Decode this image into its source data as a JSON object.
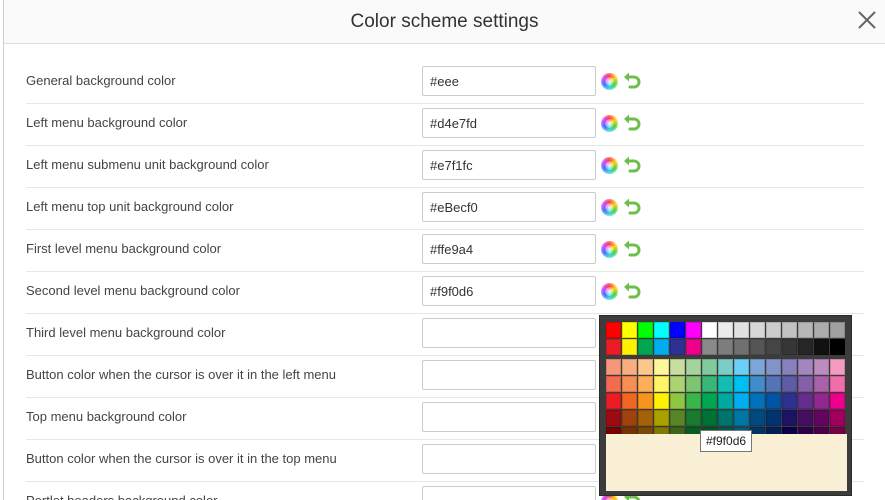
{
  "dialog": {
    "title": "Color scheme settings",
    "close_icon": "close-icon"
  },
  "settings": [
    {
      "label": "General background color",
      "value": "#eee"
    },
    {
      "label": "Left menu background color",
      "value": "#d4e7fd"
    },
    {
      "label": "Left menu submenu unit background color",
      "value": "#e7f1fc"
    },
    {
      "label": "Left menu top unit background color",
      "value": "#eBecf0"
    },
    {
      "label": "First level menu background color",
      "value": "#ffe9a4"
    },
    {
      "label": "Second level menu background color",
      "value": "#f9f0d6"
    },
    {
      "label": "Third level menu background color",
      "value": ""
    },
    {
      "label": "Button color when the cursor is over it in the left menu",
      "value": ""
    },
    {
      "label": "Top menu background color",
      "value": ""
    },
    {
      "label": "Button color when the cursor is over it in the top menu",
      "value": ""
    },
    {
      "label": "Portlet headers background color",
      "value": ""
    }
  ],
  "icons": {
    "color_wheel": "color-wheel-icon",
    "reset": "undo-arrow-icon"
  },
  "colors": {
    "reset_icon": "#6cbf4a",
    "picker_background": "#3c3c3c"
  },
  "picker": {
    "selected_value": "#f9f0d6",
    "palette_rows": [
      [
        "#ff0000",
        "#ffff00",
        "#00ff00",
        "#00ffff",
        "#0000ff",
        "#ff00ff",
        "#ffffff",
        "#ebebeb",
        "#e1e1e1",
        "#d7d7d7",
        "#cccccc",
        "#c2c2c2",
        "#b7b7b7",
        "#acacac",
        "#a0a0a0"
      ],
      [
        "#ed1c24",
        "#fff200",
        "#00a650",
        "#00aeef",
        "#2e3192",
        "#ec008c",
        "#898989",
        "#7d7d7d",
        "#707070",
        "#555555",
        "#464646",
        "#363636",
        "#262626",
        "#111111",
        "#000000"
      ],
      [
        "#f7977a",
        "#fbad82",
        "#fdc68c",
        "#fff799",
        "#c6df9c",
        "#a4d49d",
        "#81ca9d",
        "#7bcdc9",
        "#6ccff7",
        "#7ca6d8",
        "#8293ca",
        "#8881be",
        "#a286bd",
        "#bc8cbf",
        "#f49bc1"
      ],
      [
        "#f26c4f",
        "#f68e55",
        "#fbaf5a",
        "#fff467",
        "#acd372",
        "#7dc473",
        "#39b778",
        "#16bcb4",
        "#00bff3",
        "#438ccb",
        "#5573b7",
        "#5e5ca7",
        "#855fa8",
        "#a763a9",
        "#ef6ea8"
      ],
      [
        "#ed1c24",
        "#f26522",
        "#f7941d",
        "#fff200",
        "#8dc63f",
        "#39b54a",
        "#00a651",
        "#00a99d",
        "#00aeef",
        "#0072bc",
        "#0054a5",
        "#2e3192",
        "#662d91",
        "#92278f",
        "#ec008c"
      ],
      [
        "#9d0a0f",
        "#a1410d",
        "#a36209",
        "#aba000",
        "#588528",
        "#197b30",
        "#007236",
        "#00736a",
        "#0076a4",
        "#004a80",
        "#003370",
        "#1d1363",
        "#450e61",
        "#62055f",
        "#9e005c"
      ],
      [
        "#790000",
        "#7b3000",
        "#7c4900",
        "#827a00",
        "#3e6617",
        "#045f20",
        "#005824",
        "#005951",
        "#005b7e",
        "#003562",
        "#002056",
        "#0c004b",
        "#30004a",
        "#4b0048",
        "#7a0045"
      ]
    ]
  }
}
